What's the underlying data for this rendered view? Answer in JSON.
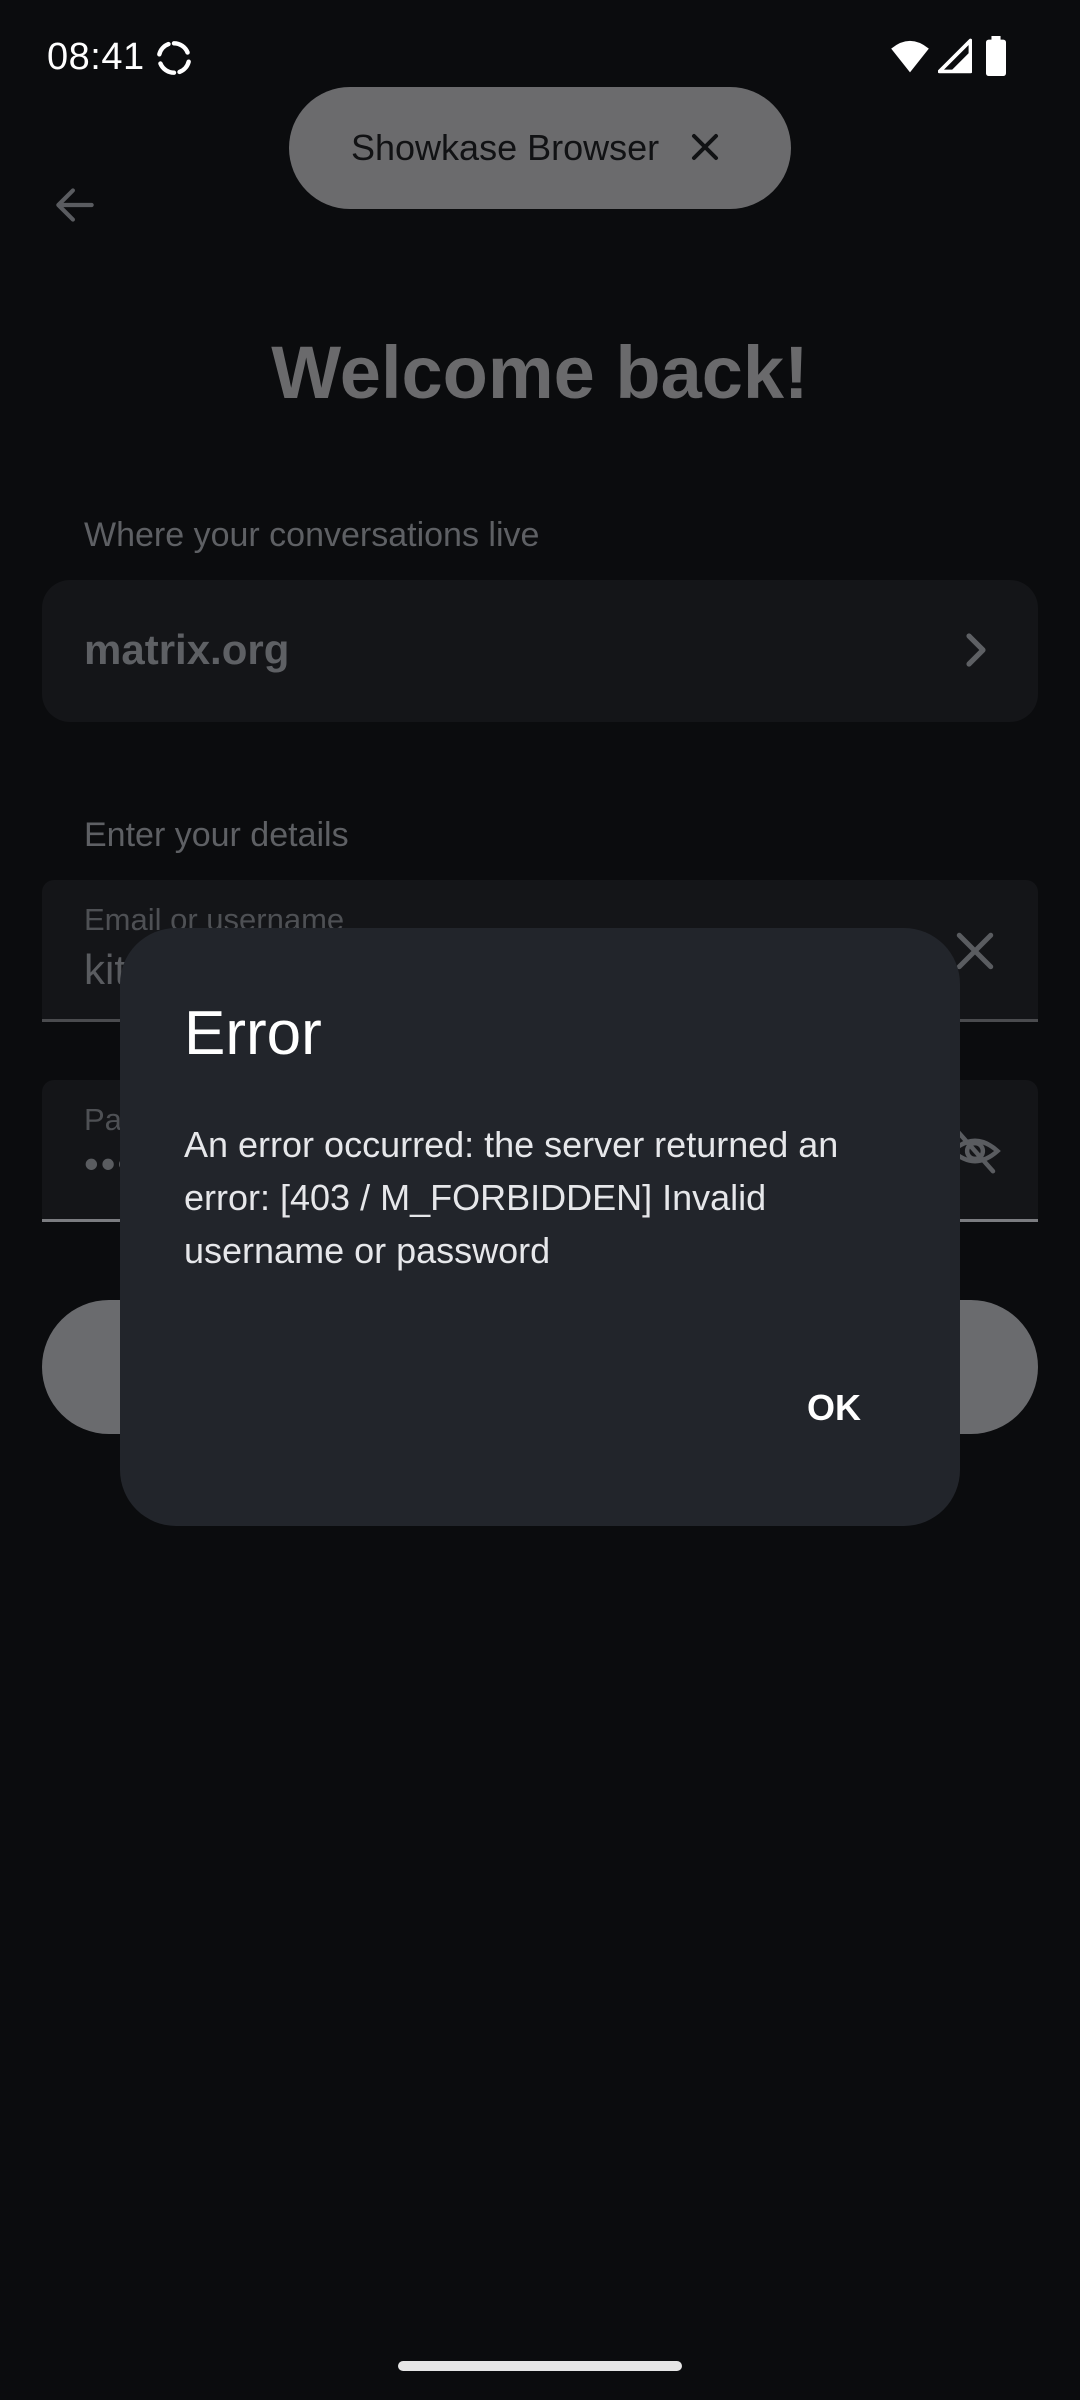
{
  "status_bar": {
    "time": "08:41",
    "icons": [
      "sync-icon",
      "wifi-icon",
      "signal-icon",
      "battery-icon"
    ]
  },
  "showkase": {
    "label": "Showkase Browser",
    "close_icon": "close-icon"
  },
  "login": {
    "title": "Welcome back!",
    "server_section_label": "Where your conversations live",
    "server_value": "matrix.org",
    "details_section_label": "Enter your details",
    "username_label": "Email or username",
    "username_value": "kit",
    "password_label": "Pa",
    "password_value": "•••"
  },
  "dialog": {
    "title": "Error",
    "message": "An error occurred: the server returned an error: [403 / M_FORBIDDEN] Invalid username or password",
    "ok_label": "OK"
  },
  "colors": {
    "background": "#0b0c0e",
    "dialog_surface": "#22252b",
    "pill": "#6b6b6d"
  }
}
